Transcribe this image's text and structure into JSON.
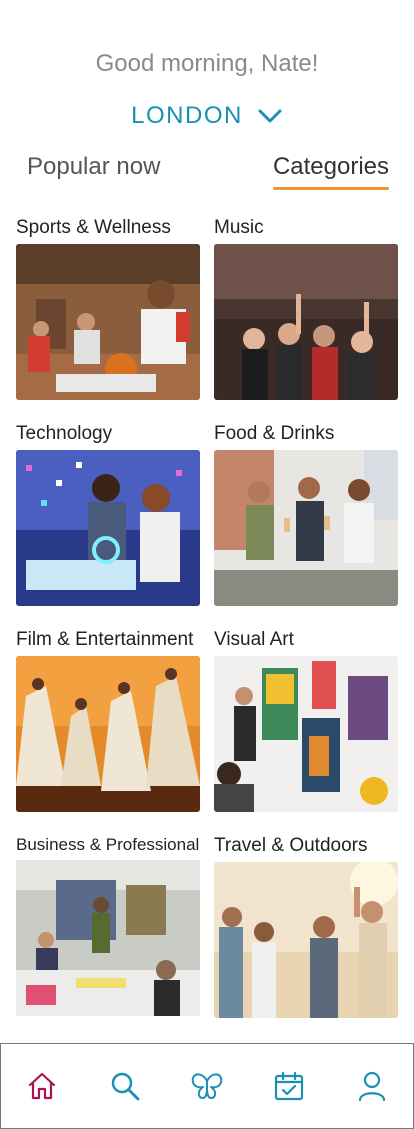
{
  "header": {
    "greeting": "Good morning, Nate!",
    "city": "LONDON"
  },
  "tabs": {
    "popular": "Popular now",
    "categories": "Categories",
    "active": "categories"
  },
  "categories": [
    {
      "label": "Sports & Wellness",
      "image": "basketball-players-photo"
    },
    {
      "label": "Music",
      "image": "concert-crowd-photo"
    },
    {
      "label": "Technology",
      "image": "tech-exhibit-photo"
    },
    {
      "label": "Food & Drinks",
      "image": "friends-toasting-photo"
    },
    {
      "label": "Film & Entertainment",
      "image": "dancers-stage-photo"
    },
    {
      "label": "Visual Art",
      "image": "art-gallery-photo"
    },
    {
      "label": "Business & Professional",
      "image": "workshop-meeting-photo"
    },
    {
      "label": "Travel & Outdoors",
      "image": "friends-outdoors-photo"
    }
  ],
  "nav": {
    "items": [
      "home-icon",
      "search-icon",
      "butterfly-icon",
      "calendar-check-icon",
      "profile-icon"
    ],
    "active": "home-icon",
    "active_color": "#b0124f",
    "color": "#1b8fb4"
  },
  "colors": {
    "accent": "#1b8fb4",
    "underline": "#f0962e",
    "active_nav": "#b0124f"
  }
}
